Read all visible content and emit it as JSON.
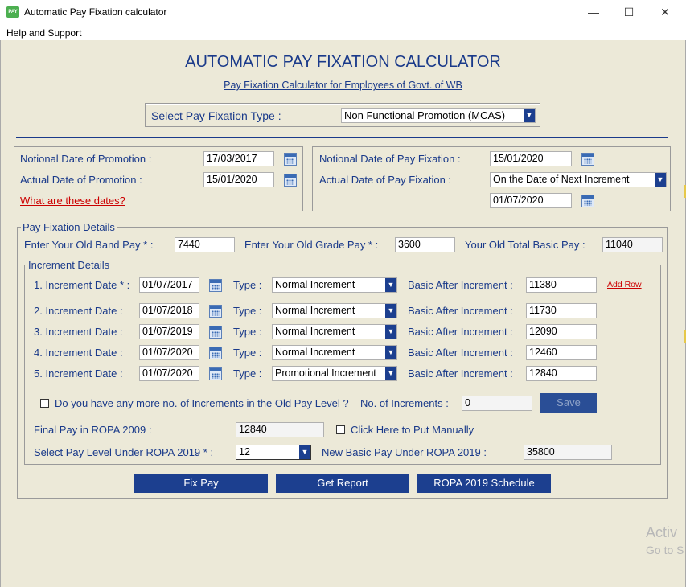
{
  "window": {
    "title": "Automatic Pay Fixation calculator",
    "icon_text": "PAY",
    "minimize": "—",
    "maximize": "☐",
    "close": "✕",
    "menu": "Help and Support"
  },
  "header": {
    "title": "AUTOMATIC PAY FIXATION CALCULATOR",
    "subtitle": "Pay Fixation Calculator for Employees of Govt. of WB"
  },
  "fixation_type": {
    "label": "Select Pay Fixation Type :",
    "value": "Non Functional Promotion (MCAS)"
  },
  "dates_left": {
    "notional_label": "Notional Date of Promotion :",
    "notional_value": "17/03/2017",
    "actual_label": "Actual Date of Promotion :",
    "actual_value": "15/01/2020",
    "help_link": "What are these dates?"
  },
  "dates_right": {
    "notional_label": "Notional Date of Pay Fixation :",
    "notional_value": "15/01/2020",
    "actual_label": "Actual Date of Pay Fixation :",
    "actual_option": "On the Date of Next Increment",
    "actual_value": "01/07/2020"
  },
  "pay_details": {
    "legend": "Pay Fixation Details",
    "band_label": "Enter Your Old Band Pay * :",
    "band_value": "7440",
    "grade_label": "Enter Your Old Grade Pay * :",
    "grade_value": "3600",
    "total_label": "Your Old Total Basic Pay :",
    "total_value": "11040"
  },
  "increments": {
    "legend": "Increment Details",
    "type_label": "Type :",
    "basic_label": "Basic After Increment :",
    "add_row": "Add Row",
    "rows": [
      {
        "label": "1. Increment Date * :",
        "date": "01/07/2017",
        "type": "Normal Increment",
        "basic": "11380"
      },
      {
        "label": "2. Increment Date :",
        "date": "01/07/2018",
        "type": "Normal Increment",
        "basic": "11730"
      },
      {
        "label": "3. Increment Date :",
        "date": "01/07/2019",
        "type": "Normal Increment",
        "basic": "12090"
      },
      {
        "label": "4. Increment Date :",
        "date": "01/07/2020",
        "type": "Normal Increment",
        "basic": "12460"
      },
      {
        "label": "5. Increment Date :",
        "date": "01/07/2020",
        "type": "Promotional Increment",
        "basic": "12840"
      }
    ],
    "more_label": "Do you have any more no. of Increments in the Old Pay Level ?",
    "count_label": "No. of Increments :",
    "count_value": "0",
    "save": "Save",
    "final_label": "Final Pay in ROPA 2009 :",
    "final_value": "12840",
    "manual_label": "Click Here to Put Manually",
    "level_label": "Select Pay Level Under ROPA 2019 * :",
    "level_value": "12",
    "new_basic_label": "New Basic Pay Under ROPA 2019 :",
    "new_basic_value": "35800"
  },
  "actions": {
    "fix_pay": "Fix Pay",
    "report": "Get Report",
    "schedule": "ROPA 2019 Schedule"
  },
  "watermark": {
    "line1": "Activ",
    "line2": "Go to S"
  }
}
